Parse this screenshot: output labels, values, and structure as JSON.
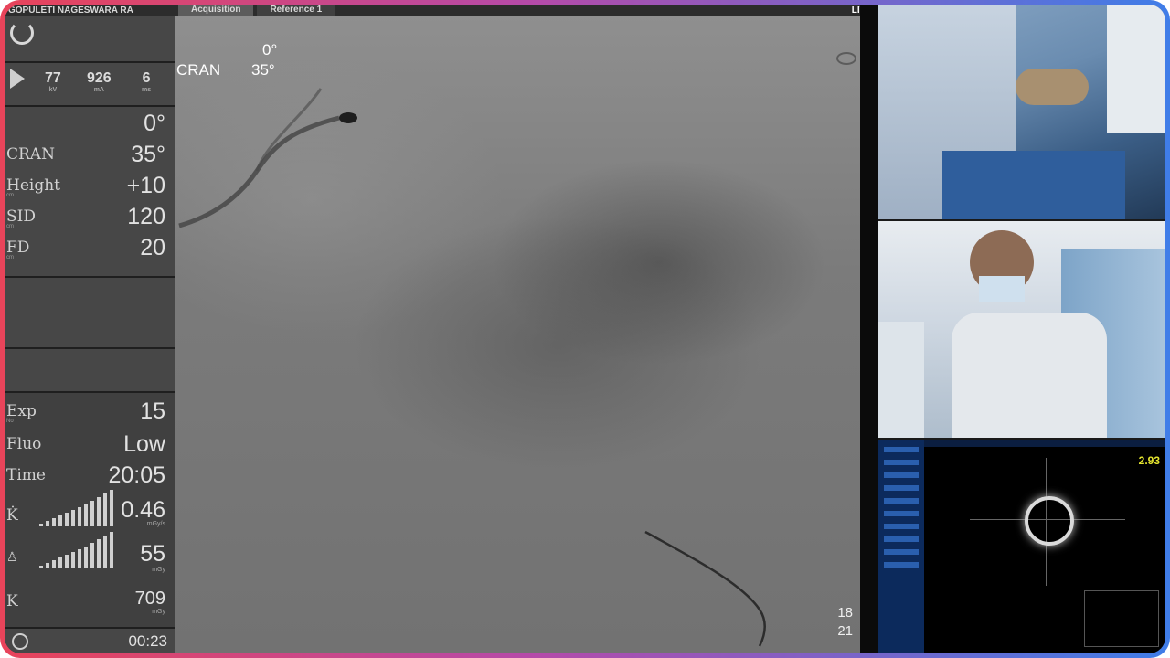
{
  "topbar": {
    "patient_name": "GOPULETI NAGESWARA RA",
    "tab_acquisition": "Acquisition",
    "tab_reference": "Reference 1",
    "live": "LIVE"
  },
  "left_panel": {
    "exposure": [
      {
        "value": "77",
        "unit": "kV"
      },
      {
        "value": "926",
        "unit": "mA"
      },
      {
        "value": "6",
        "unit": "ms"
      }
    ],
    "geometry": {
      "rotation_value": "0°",
      "angulation_label": "CRAN",
      "angulation_value": "35°",
      "height_label": "Height",
      "height_unit": "cm",
      "height_value": "+10",
      "sid_label": "SID",
      "sid_unit": "cm",
      "sid_value": "120",
      "fd_label": "FD",
      "fd_unit": "cm",
      "fd_value": "20"
    },
    "dose": {
      "exp_label": "Exp",
      "exp_unit": "No",
      "exp_value": "15",
      "fluo_label": "Fluo",
      "fluo_value": "Low",
      "time_label": "Time",
      "time_value": "20:05",
      "k_dot_label": "K̇",
      "k_dot_value": "0.46",
      "k_dot_unit": "mGy/s",
      "patient_value": "55",
      "patient_unit": "mGy",
      "k_label": "K",
      "k_value": "709",
      "k_unit": "mGy"
    },
    "timer": "00:23"
  },
  "image_view": {
    "angle_top": "0°",
    "angle_label": "CRAN",
    "angle_value": "35°",
    "corner_top": "18",
    "corner_bottom": "21"
  },
  "ivus": {
    "readout": "2.93"
  }
}
